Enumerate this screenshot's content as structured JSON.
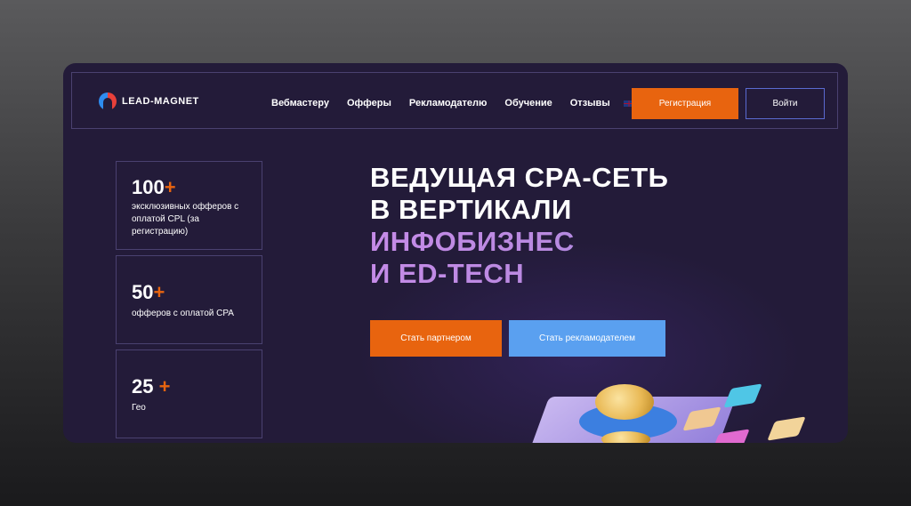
{
  "brand": {
    "name": "LEAD-MAGNET"
  },
  "nav": {
    "items": [
      "Вебмастеру",
      "Офферы",
      "Рекламодателю",
      "Обучение",
      "Отзывы"
    ],
    "register_label": "Регистрация",
    "login_label": "Войти"
  },
  "stats": [
    {
      "value": "100",
      "plus": "+",
      "desc": "эксклюзивных офферов с оплатой CPL (за регистрацию)"
    },
    {
      "value": "50",
      "plus": "+",
      "desc": "офферов с оплатой CPA"
    },
    {
      "value": "25 ",
      "plus": "+",
      "desc": "Гео"
    }
  ],
  "hero": {
    "line1": "ВЕДУЩАЯ CPA-СЕТЬ",
    "line2": "В ВЕРТИКАЛИ",
    "line3": "ИНФОБИЗНЕС",
    "line4": "И ED-TECH",
    "cta_partner": "Стать партнером",
    "cta_advertiser": "Стать рекламодателем"
  },
  "colors": {
    "background": "#231b39",
    "accent_orange": "#e8640f",
    "accent_blue": "#5aa0f0",
    "accent_purple": "#c58be8"
  }
}
